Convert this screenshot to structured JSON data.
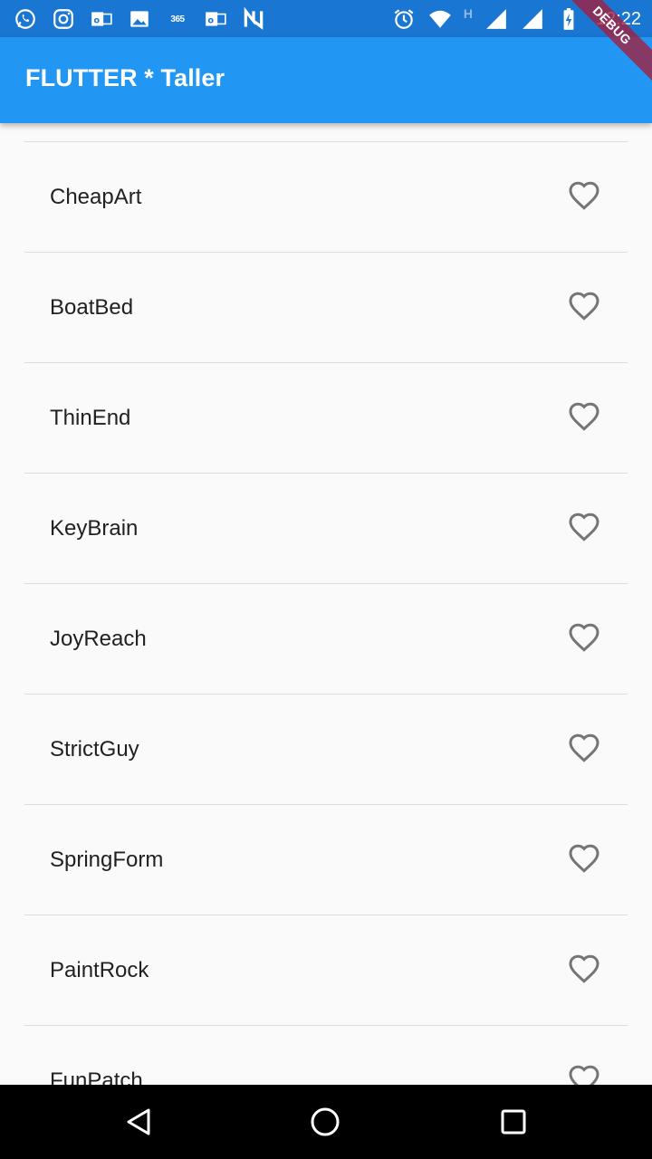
{
  "status_bar": {
    "left_icons": [
      "whatsapp-icon",
      "instagram-icon",
      "outlook-icon",
      "gallery-icon",
      "office365-icon",
      "outlook-icon",
      "nfc-icon"
    ],
    "office_text": "365",
    "network_mark": "H",
    "time": "12:22",
    "right_icons": [
      "alarm-icon",
      "wifi-icon",
      "signal-icon",
      "signal-icon",
      "battery-charging-icon"
    ]
  },
  "app_bar": {
    "title": "FLUTTER * Taller",
    "color": "#2196f3"
  },
  "debug_banner": "DEBUG",
  "list": {
    "items": [
      {
        "label": "CheapArt",
        "favorite": false
      },
      {
        "label": "BoatBed",
        "favorite": false
      },
      {
        "label": "ThinEnd",
        "favorite": false
      },
      {
        "label": "KeyBrain",
        "favorite": false
      },
      {
        "label": "JoyReach",
        "favorite": false
      },
      {
        "label": "StrictGuy",
        "favorite": false
      },
      {
        "label": "SpringForm",
        "favorite": false
      },
      {
        "label": "PaintRock",
        "favorite": false
      },
      {
        "label": "FunPatch",
        "favorite": false
      }
    ],
    "favorite_icon": "heart-outline-icon"
  },
  "nav_bar": {
    "buttons": [
      "back-icon",
      "home-icon",
      "recents-icon"
    ]
  }
}
